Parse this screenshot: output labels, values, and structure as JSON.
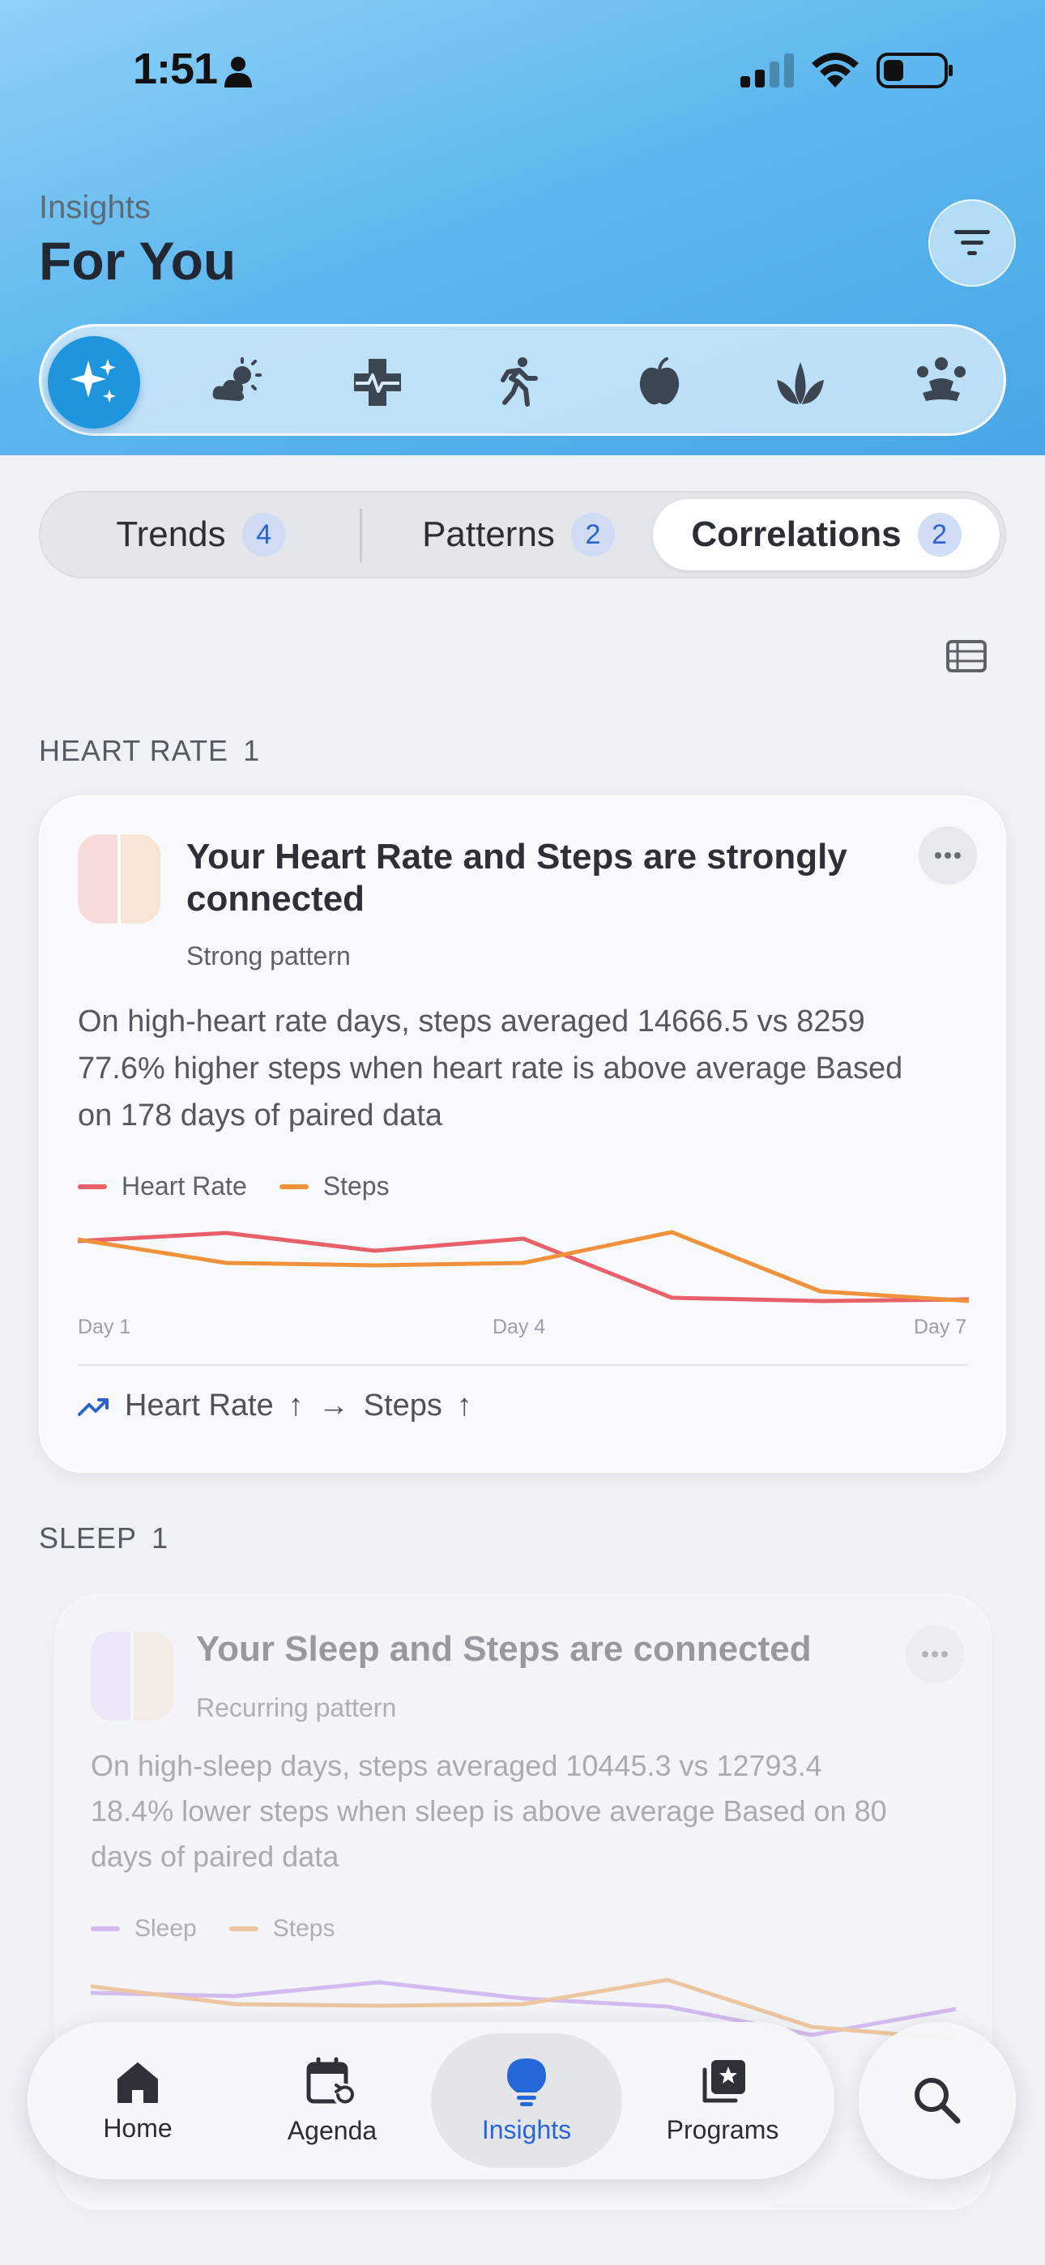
{
  "status_bar": {
    "time": "1:51"
  },
  "header": {
    "subtitle": "Insights",
    "title": "For You"
  },
  "categories": [
    {
      "icon": "sparkles-icon",
      "active": true
    },
    {
      "icon": "weather-sun-icon",
      "active": false
    },
    {
      "icon": "health-cross-icon",
      "active": false
    },
    {
      "icon": "running-person-icon",
      "active": false
    },
    {
      "icon": "apple-icon",
      "active": false
    },
    {
      "icon": "leaf-icon",
      "active": false
    },
    {
      "icon": "meditation-icon",
      "active": false
    }
  ],
  "segments": [
    {
      "label": "Trends",
      "count": "4",
      "active": false
    },
    {
      "label": "Patterns",
      "count": "2",
      "active": false
    },
    {
      "label": "Correlations",
      "count": "2",
      "active": true
    }
  ],
  "sections": [
    {
      "header": "HEART RATE",
      "count": "1",
      "card": {
        "title_line1": "Your Heart Rate and Steps are strongly",
        "title_line2": "connected",
        "subtitle": "Strong pattern",
        "body": [
          "On high-heart rate days, steps averaged 14666.5 vs 8259",
          "77.6% higher steps when heart rate is above average Based",
          "on 178 days of paired data"
        ],
        "footer": {
          "from": "Heart Rate",
          "to": "Steps",
          "arrow_up": "↑",
          "arrow_right": "→"
        }
      }
    },
    {
      "header": "SLEEP",
      "count": "1",
      "card": {
        "title": "Your Sleep and Steps are connected",
        "subtitle": "Recurring pattern",
        "body": [
          "On high-sleep days, steps averaged 10445.3 vs 12793.4",
          "18.4% lower steps when sleep is above average Based on 80",
          "days of paired data"
        ]
      }
    }
  ],
  "chart_data": [
    {
      "type": "line",
      "x": [
        "Day 1",
        "Day 2",
        "Day 3",
        "Day 4",
        "Day 5",
        "Day 6",
        "Day 7"
      ],
      "x_tick_labels": [
        "Day 1",
        "Day 4",
        "Day 7"
      ],
      "normalized": true,
      "ylim": [
        0,
        1
      ],
      "series": [
        {
          "name": "Heart Rate",
          "color": "#e8606a",
          "values": [
            0.82,
            0.92,
            0.7,
            0.85,
            0.12,
            0.08,
            0.1
          ]
        },
        {
          "name": "Steps",
          "color": "#f0913c",
          "values": [
            0.84,
            0.55,
            0.52,
            0.55,
            0.93,
            0.2,
            0.08
          ]
        }
      ],
      "legend": "top-left",
      "grid": false
    },
    {
      "type": "line",
      "x": [
        "Day 1",
        "Day 2",
        "Day 3",
        "Day 4",
        "Day 5",
        "Day 6",
        "Day 7"
      ],
      "normalized": true,
      "ylim": [
        0,
        1
      ],
      "series": [
        {
          "name": "Sleep",
          "color": "#b57be8",
          "values": [
            0.62,
            0.58,
            0.75,
            0.55,
            0.45,
            0.1,
            0.42
          ]
        },
        {
          "name": "Steps",
          "color": "#f0913c",
          "values": [
            0.7,
            0.48,
            0.46,
            0.48,
            0.78,
            0.2,
            0.05
          ]
        }
      ],
      "legend": "top-left",
      "grid": false
    }
  ],
  "tabbar": {
    "items": [
      {
        "label": "Home",
        "icon": "home-icon",
        "active": false
      },
      {
        "label": "Agenda",
        "icon": "calendar-icon",
        "active": false
      },
      {
        "label": "Insights",
        "icon": "lightbulb-icon",
        "active": true
      },
      {
        "label": "Programs",
        "icon": "programs-icon",
        "active": false
      }
    ],
    "search_icon": "search-icon"
  },
  "colors": {
    "accent": "#1e95dc",
    "active_tab": "#2566d9",
    "count_badge_bg": "#cfdcf4",
    "hero_top": "#8ed0f8",
    "hero_bottom": "#47a6e6"
  }
}
